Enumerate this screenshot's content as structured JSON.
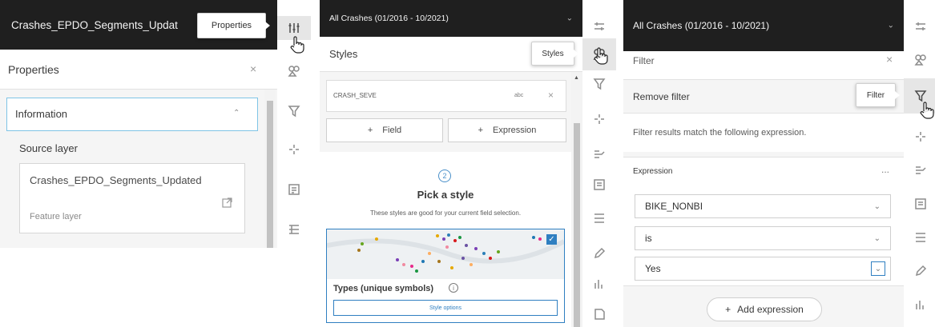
{
  "panel1": {
    "header_title": "Crashes_EPDO_Segments_Updat",
    "tooltip": "Properties",
    "section_title": "Properties",
    "group_title": "Information",
    "field_label": "Source layer",
    "source_name": "Crashes_EPDO_Segments_Updated",
    "source_type": "Feature layer"
  },
  "panel2": {
    "header_title": "All Crashes (01/2016 - 10/2021)",
    "section_title": "Styles",
    "tooltip": "Styles",
    "field_name": "CRASH_SEVE",
    "field_abbr": "abc",
    "add_field_label": "Field",
    "add_expression_label": "Expression",
    "step_number": "2",
    "pick_title": "Pick a style",
    "pick_desc": "These styles are good for your current field selection.",
    "style_card_label": "Types (unique symbols)",
    "style_options_label": "Style options",
    "map_dot_colors": [
      "#e6a800",
      "#7a3fb5",
      "#2c7fb8",
      "#d7191c",
      "#1a9641",
      "#f18aa0",
      "#6a51a3",
      "#fdae61",
      "#1f78b4",
      "#e7298a",
      "#66a61e",
      "#a6761d"
    ]
  },
  "panel3": {
    "header_title": "All Crashes (01/2016 - 10/2021)",
    "section_title": "Filter",
    "remove_filter_label": "Remove filter",
    "tooltip": "Filter",
    "info_text": "Filter results match the following expression.",
    "expression_title": "Expression",
    "more_label": "...",
    "field_value": "BIKE_NONBI",
    "operator_value": "is",
    "value_value": "Yes",
    "add_expression_label": "Add expression"
  }
}
